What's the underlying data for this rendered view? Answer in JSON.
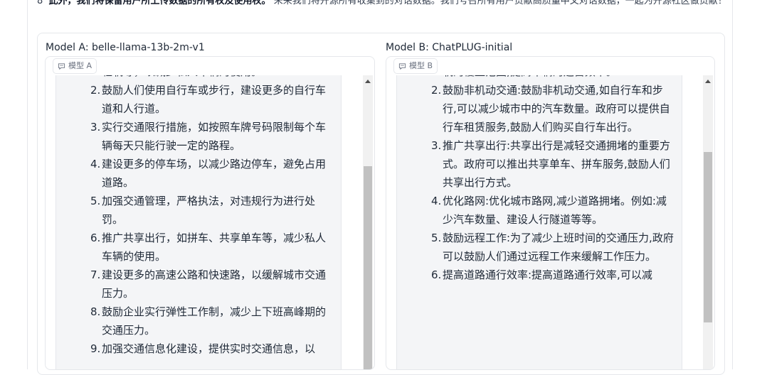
{
  "notice": {
    "index": "8",
    "bold": "此外，我们将保留用户所上传数据的所有权及使用权。",
    "rest": "未来我们将开源所有收集到的对话数据。我们号召所有用户贡献高质量中文对话数据，一起为开源社区做贡献！"
  },
  "model_a": {
    "title": "Model A: belle-llama-13b-2m-v1",
    "chip": "模型 A",
    "items": [
      {
        "num": "",
        "text": "轻轨等，以减少私人车辆的使用。"
      },
      {
        "num": "2.",
        "text": "鼓励人们使用自行车或步行，建设更多的自行车道和人行道。"
      },
      {
        "num": "3.",
        "text": "实行交通限行措施，如按照车牌号码限制每个车辆每天只能行驶一定的路程。"
      },
      {
        "num": "4.",
        "text": "建设更多的停车场，以减少路边停车，避免占用道路。"
      },
      {
        "num": "5.",
        "text": "加强交通管理，严格执法，对违规行为进行处罚。"
      },
      {
        "num": "6.",
        "text": "推广共享出行，如拼车、共享单车等，减少私人车辆的使用。"
      },
      {
        "num": "7.",
        "text": "建设更多的高速公路和快速路，以缓解城市交通压力。"
      },
      {
        "num": "8.",
        "text": "鼓励企业实行弹性工作制，减少上下班高峰期的交通压力。"
      },
      {
        "num": "9.",
        "text": "加强交通信息化建设，提供实时交通信息，以"
      }
    ]
  },
  "model_b": {
    "title": "Model B: ChatPLUG-initial",
    "chip": "模型 B",
    "items": [
      {
        "num": "",
        "text": "加快建设城市公共交通系统，提高运营效率，解道路上的交通压力。例如:增加公交车、地铁和轻轨的覆盖范围,提高车辆的运营频率。"
      },
      {
        "num": "2.",
        "text": "鼓励非机动交通:鼓励非机动交通,如自行车和步行,可以减少城市中的汽车数量。政府可以提供自行车租赁服务,鼓励人们购买自行车出行。"
      },
      {
        "num": "3.",
        "text": "推广共享出行:共享出行是减轻交通拥堵的重要方式。政府可以推出共享单车、拼车服务,鼓励人们共享出行方式。"
      },
      {
        "num": "4.",
        "text": "优化路网:优化城市路网,减少道路拥堵。例如:减少汽车数量、建设人行隧道等等。"
      },
      {
        "num": "5.",
        "text": "鼓励远程工作:为了减少上班时间的交通压力,政府可以鼓励人们通过远程工作来缓解工作压力。"
      },
      {
        "num": "6.",
        "text": "提高道路通行效率:提高道路通行效率,可以减"
      }
    ]
  },
  "colors": {
    "panel_bg": "#f4f5f7",
    "border": "#e5e7eb",
    "scroll_thumb": "#c1c1c1"
  },
  "icons": {
    "chip_icon": "chat-bubble-icon",
    "scroll_up": "arrow-up-icon"
  }
}
